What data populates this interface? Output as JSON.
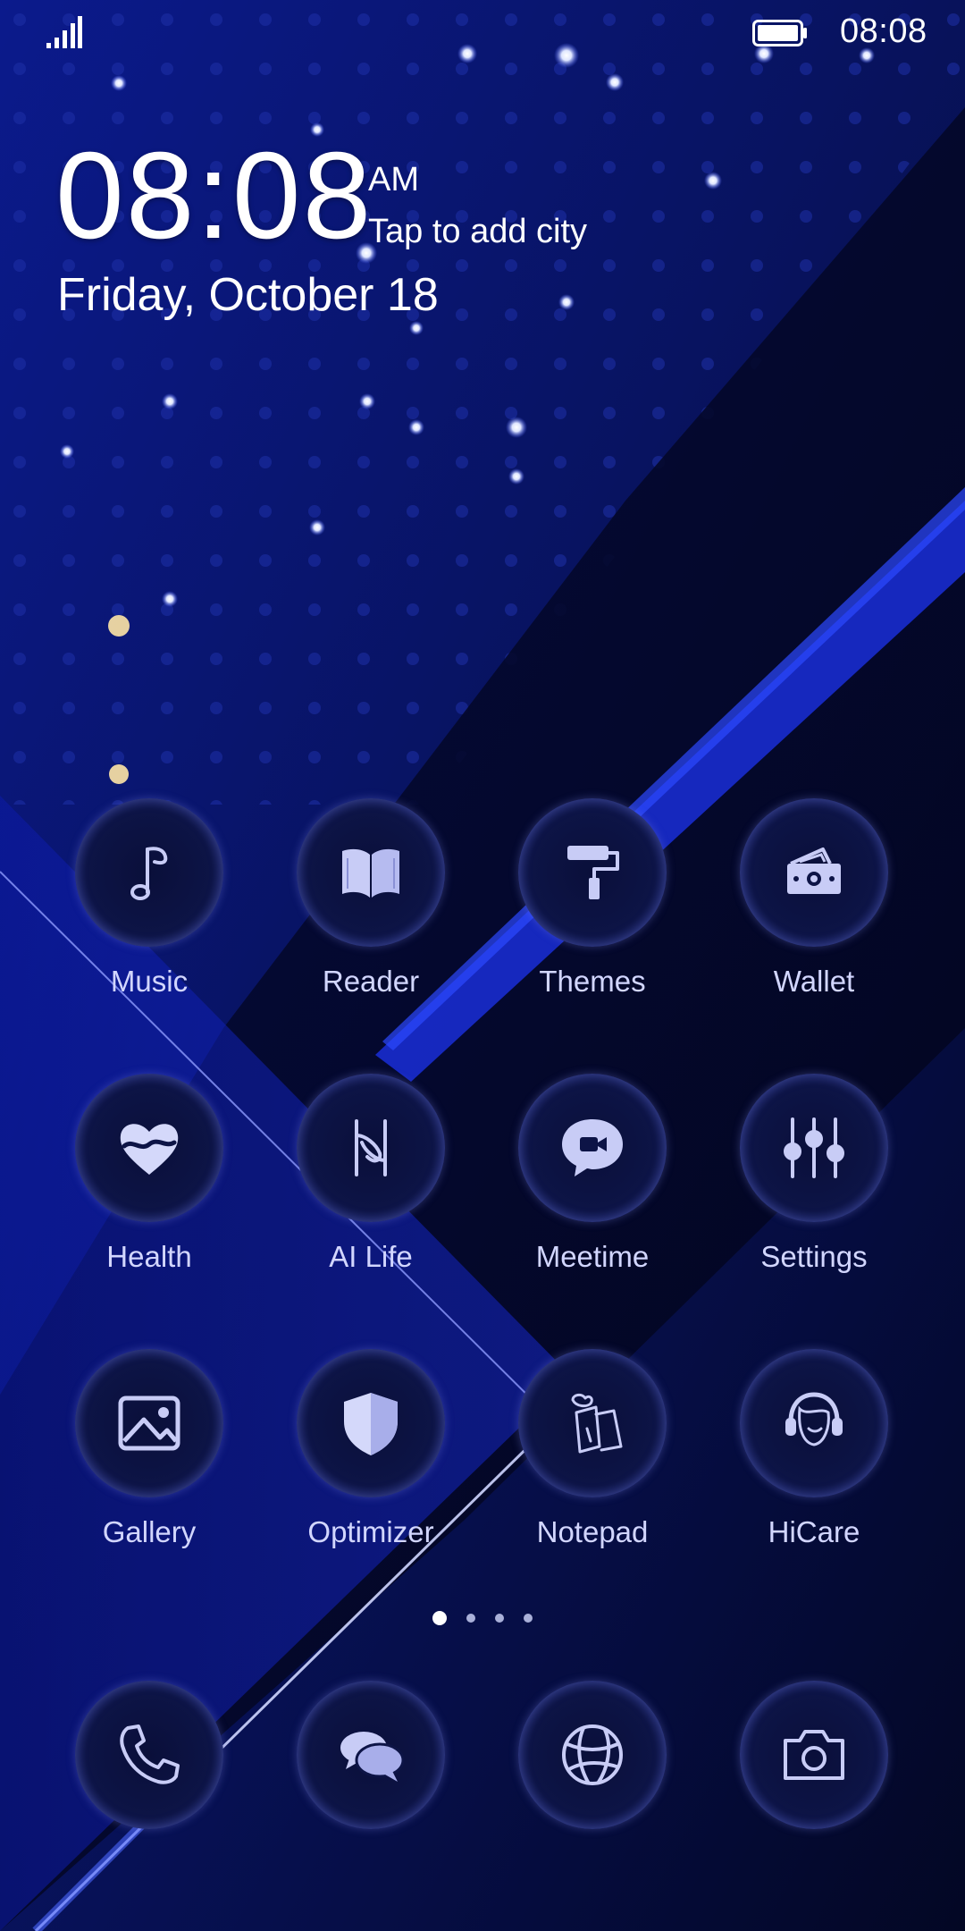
{
  "status_bar": {
    "time": "08:08"
  },
  "clock": {
    "time": "08:08",
    "ampm": "AM",
    "city": "Tap to add city",
    "date": "Friday, October 18"
  },
  "apps": [
    {
      "label": "Music",
      "icon": "music-note-icon"
    },
    {
      "label": "Reader",
      "icon": "book-icon"
    },
    {
      "label": "Themes",
      "icon": "paint-roller-icon"
    },
    {
      "label": "Wallet",
      "icon": "wallet-icon"
    },
    {
      "label": "Health",
      "icon": "heart-icon"
    },
    {
      "label": "AI Life",
      "icon": "ai-life-icon"
    },
    {
      "label": "Meetime",
      "icon": "video-chat-icon"
    },
    {
      "label": "Settings",
      "icon": "sliders-icon"
    },
    {
      "label": "Gallery",
      "icon": "image-icon"
    },
    {
      "label": "Optimizer",
      "icon": "shield-icon"
    },
    {
      "label": "Notepad",
      "icon": "notepad-icon"
    },
    {
      "label": "HiCare",
      "icon": "headset-icon"
    }
  ],
  "pager": {
    "pages": 4,
    "current": 1
  },
  "dock": [
    {
      "icon": "phone-icon"
    },
    {
      "icon": "messages-icon"
    },
    {
      "icon": "browser-icon"
    },
    {
      "icon": "camera-icon"
    }
  ],
  "colors": {
    "background": "#050a3a",
    "accent_blue": "#1a2ed8",
    "icon_tint": "#c8ccf6",
    "label": "#d2d6ff"
  }
}
